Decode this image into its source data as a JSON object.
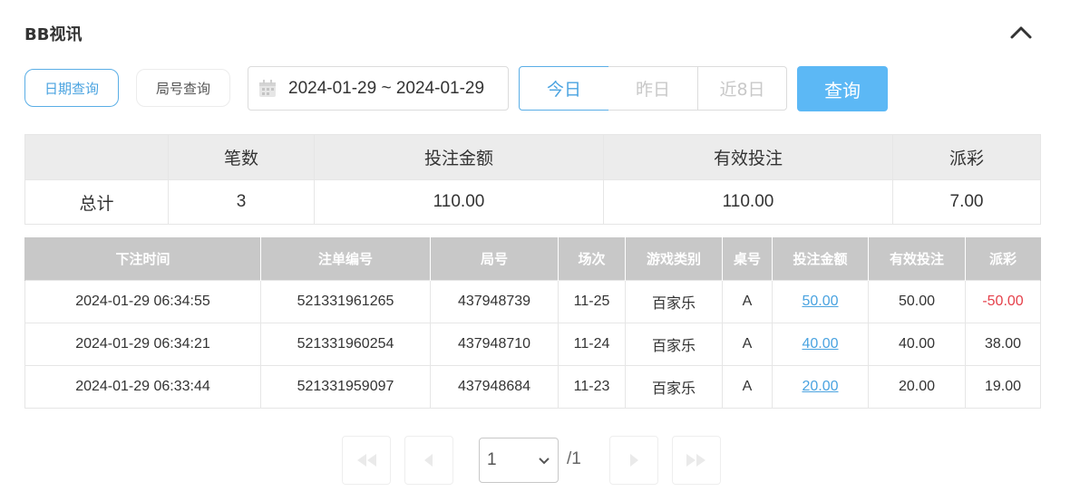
{
  "header": {
    "title": "BB视讯"
  },
  "filters": {
    "date_query_label": "日期查询",
    "round_query_label": "局号查询",
    "date_range": "2024-01-29 ~ 2024-01-29",
    "today_label": "今日",
    "yesterday_label": "昨日",
    "last8_label": "近8日",
    "search_label": "查询"
  },
  "summary": {
    "headers": [
      "",
      "笔数",
      "投注金额",
      "有效投注",
      "派彩"
    ],
    "row": {
      "label": "总计",
      "count": "3",
      "bet": "110.00",
      "valid": "110.00",
      "payout": "7.00"
    }
  },
  "detail": {
    "headers": [
      "下注时间",
      "注单编号",
      "局号",
      "场次",
      "游戏类别",
      "桌号",
      "投注金额",
      "有效投注",
      "派彩"
    ],
    "rows": [
      {
        "time": "2024-01-29 06:34:55",
        "bet_id": "521331961265",
        "round": "437948739",
        "session": "11-25",
        "game": "百家乐",
        "table": "A",
        "bet": "50.00",
        "valid": "50.00",
        "payout": "-50.00"
      },
      {
        "time": "2024-01-29 06:34:21",
        "bet_id": "521331960254",
        "round": "437948710",
        "session": "11-24",
        "game": "百家乐",
        "table": "A",
        "bet": "40.00",
        "valid": "40.00",
        "payout": "38.00"
      },
      {
        "time": "2024-01-29 06:33:44",
        "bet_id": "521331959097",
        "round": "437948684",
        "session": "11-23",
        "game": "百家乐",
        "table": "A",
        "bet": "20.00",
        "valid": "20.00",
        "payout": "19.00"
      }
    ]
  },
  "pagination": {
    "current": "1",
    "total": "/1"
  },
  "colors": {
    "accent": "#5cb8f5",
    "negative": "#e5414b",
    "header_gray": "#c8c8c8"
  }
}
